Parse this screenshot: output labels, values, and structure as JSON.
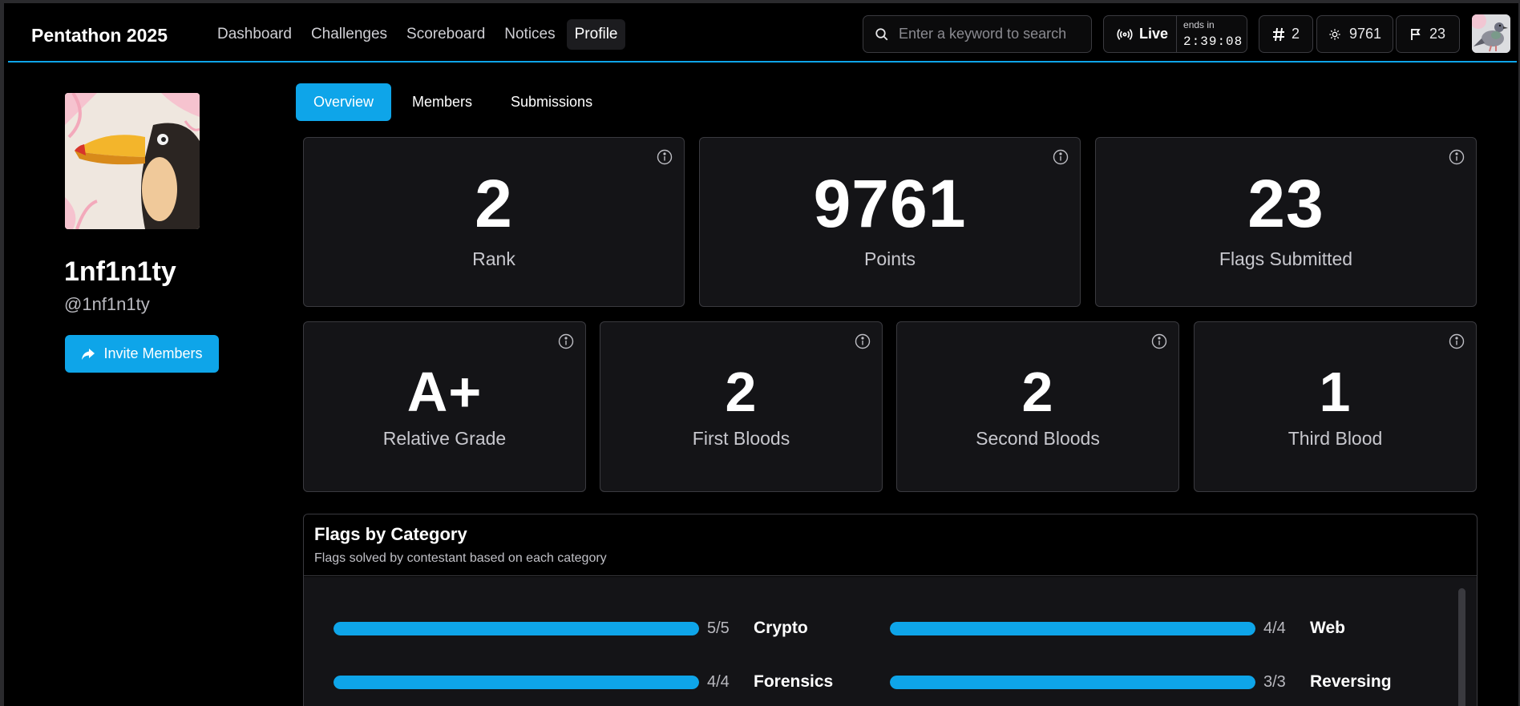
{
  "nav": {
    "brand": "Pentathon 2025",
    "links": [
      "Dashboard",
      "Challenges",
      "Scoreboard",
      "Notices",
      "Profile"
    ],
    "active": "Profile",
    "search_placeholder": "Enter a keyword to search",
    "live_label": "Live",
    "ends_in_label": "ends in",
    "timer": "2:39:08",
    "rank": "2",
    "points": "9761",
    "flags": "23"
  },
  "profile": {
    "team_name": "1nf1n1ty",
    "handle": "@1nf1n1ty",
    "invite_label": "Invite Members"
  },
  "tabs": [
    "Overview",
    "Members",
    "Submissions"
  ],
  "stats_row1": [
    {
      "value": "2",
      "label": "Rank"
    },
    {
      "value": "9761",
      "label": "Points"
    },
    {
      "value": "23",
      "label": "Flags Submitted"
    }
  ],
  "stats_row2": [
    {
      "value": "A+",
      "label": "Relative Grade"
    },
    {
      "value": "2",
      "label": "First Bloods"
    },
    {
      "value": "2",
      "label": "Second Bloods"
    },
    {
      "value": "1",
      "label": "Third Blood"
    }
  ],
  "flags_by_category": {
    "title": "Flags by Category",
    "subtitle": "Flags solved by contestant based on each category",
    "categories": [
      {
        "name": "Crypto",
        "count": "5/5",
        "progress": 1.0
      },
      {
        "name": "Web",
        "count": "4/4",
        "progress": 1.0
      },
      {
        "name": "Forensics",
        "count": "4/4",
        "progress": 1.0
      },
      {
        "name": "Reversing",
        "count": "3/3",
        "progress": 1.0
      }
    ]
  },
  "colors": {
    "accent": "#0ea5e9",
    "card_bg": "#141417",
    "border": "#3a3a3f"
  }
}
